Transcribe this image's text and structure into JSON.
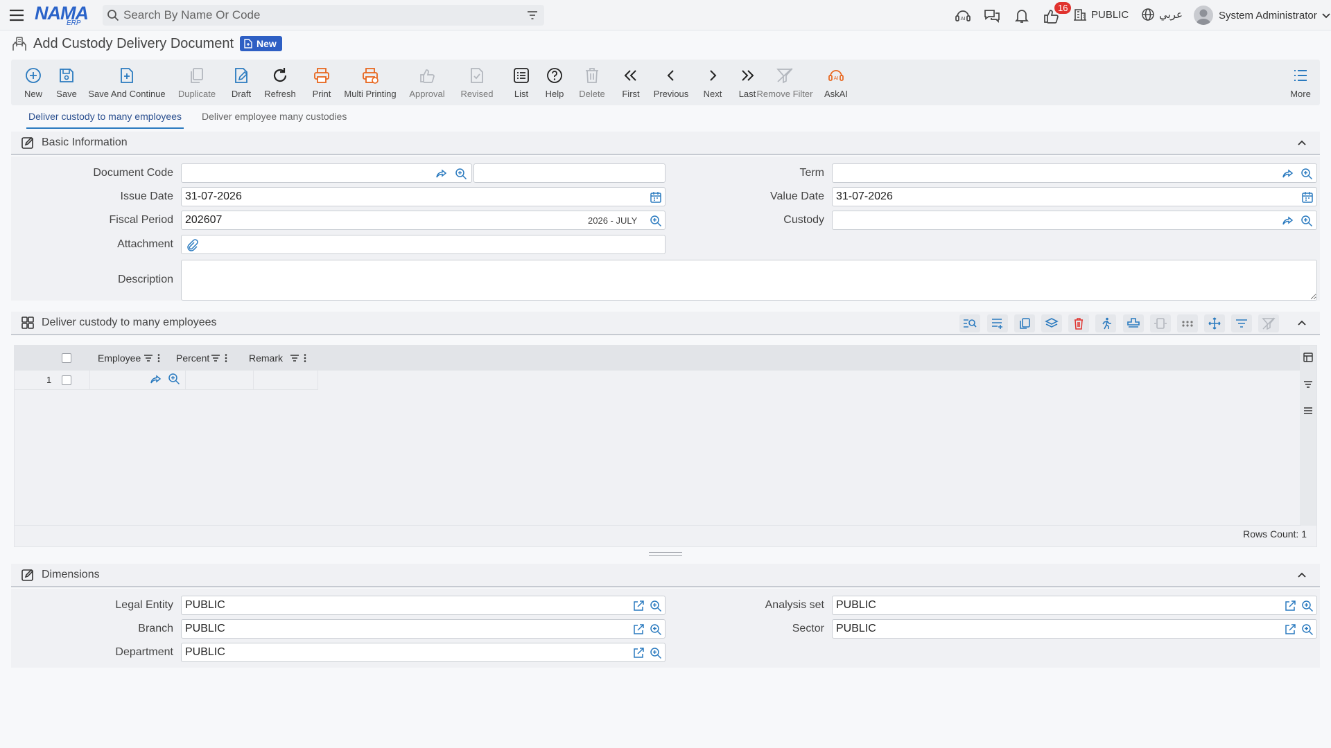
{
  "app": {
    "logo_text": "NAMA",
    "logo_sub": "ERP",
    "search_placeholder": "Search By Name Or Code",
    "notifications_count": "16",
    "company": "PUBLIC",
    "language": "عربي",
    "user_name": "System Administrator"
  },
  "page": {
    "title": "Add Custody Delivery Document",
    "status_badge": "New"
  },
  "toolbar": {
    "new": "New",
    "save": "Save",
    "save_continue": "Save And Continue",
    "duplicate": "Duplicate",
    "draft": "Draft",
    "refresh": "Refresh",
    "print": "Print",
    "multi_printing": "Multi Printing",
    "approval": "Approval",
    "revised": "Revised",
    "list": "List",
    "help": "Help",
    "delete": "Delete",
    "first": "First",
    "previous": "Previous",
    "next": "Next",
    "last": "Last",
    "remove_filter": "Remove Filter",
    "askai": "AskAI",
    "more": "More"
  },
  "tabs": [
    {
      "label": "Deliver custody to many employees",
      "active": true
    },
    {
      "label": "Deliver employee many custodies",
      "active": false
    }
  ],
  "basic_info": {
    "section_title": "Basic Information",
    "document_code_label": "Document Code",
    "document_code_value": "",
    "issue_date_label": "Issue Date",
    "issue_date_value": "31-07-2026",
    "fiscal_period_label": "Fiscal Period",
    "fiscal_period_value": "202607",
    "fiscal_period_name": "2026 - JULY",
    "attachment_label": "Attachment",
    "description_label": "Description",
    "description_value": "",
    "term_label": "Term",
    "term_value": "",
    "value_date_label": "Value Date",
    "value_date_value": "31-07-2026",
    "custody_label": "Custody",
    "custody_value": ""
  },
  "lines": {
    "section_title": "Deliver custody to many employees",
    "columns": [
      "Employee",
      "Percent",
      "Remark"
    ],
    "rows": [
      {
        "num": "1",
        "employee": "",
        "percent": "",
        "remark": ""
      }
    ],
    "rows_count_text": "Rows Count: 1"
  },
  "dimensions": {
    "section_title": "Dimensions",
    "legal_entity_label": "Legal Entity",
    "legal_entity_value": "PUBLIC",
    "branch_label": "Branch",
    "branch_value": "PUBLIC",
    "department_label": "Department",
    "department_value": "PUBLIC",
    "analysis_set_label": "Analysis set",
    "analysis_set_value": "PUBLIC",
    "sector_label": "Sector",
    "sector_value": "PUBLIC"
  },
  "colors": {
    "accent": "#2a7abf",
    "print_orange": "#e8651c",
    "badge_blue": "#2e5fc4",
    "danger_red": "#e0322e"
  }
}
